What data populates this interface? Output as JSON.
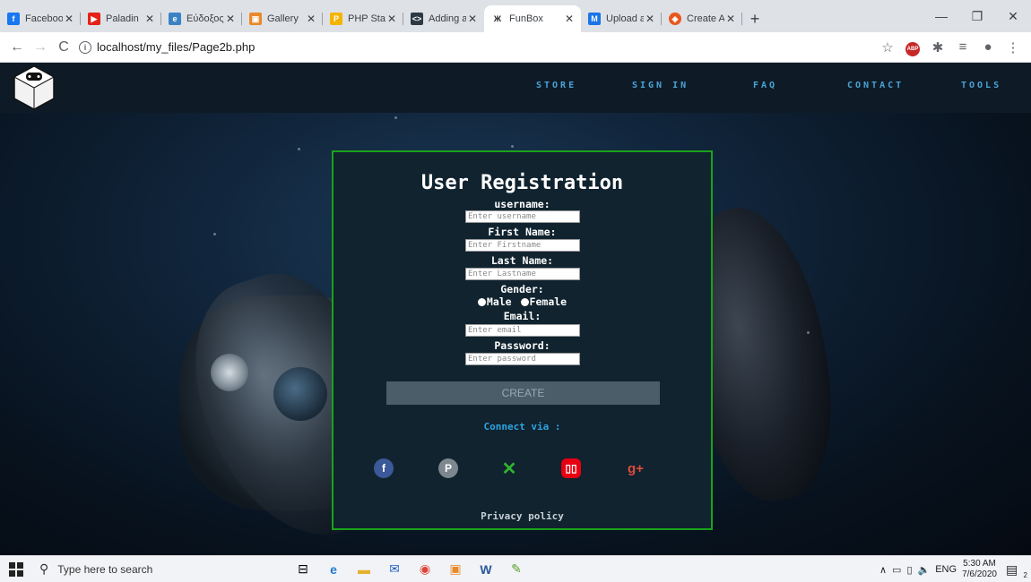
{
  "browser": {
    "tabs": [
      {
        "title": "Facebook",
        "icon": "facebook-icon",
        "color": "#1877f2"
      },
      {
        "title": "Paladin",
        "icon": "youtube-icon",
        "color": "#e62117"
      },
      {
        "title": "Εύδοξος | Σ",
        "icon": "eudoxus-icon",
        "color": "#3b82c4"
      },
      {
        "title": "Gallery",
        "icon": "gallery-icon",
        "color": "#e8892a"
      },
      {
        "title": "PHP Star Ra",
        "icon": "php-icon",
        "color": "#f4b400"
      },
      {
        "title": "Adding a G",
        "icon": "code-icon",
        "color": "#2d3a44"
      },
      {
        "title": "FunBox",
        "icon": "funbox-icon",
        "color": "#222222",
        "active": true
      },
      {
        "title": "Upload and",
        "icon": "upload-icon",
        "color": "#1a73e8"
      },
      {
        "title": "Create A Si",
        "icon": "create-icon",
        "color": "#e8581c"
      }
    ],
    "url": "localhost/my_files/Page2b.php"
  },
  "site": {
    "nav": {
      "store": "STORE",
      "signin": "SIGN IN",
      "faq": "FAQ",
      "contact": "CONTACT",
      "tools": "TOOLS"
    }
  },
  "form": {
    "title": "User Registration",
    "username_label": "username:",
    "username_placeholder": "Enter username",
    "firstname_label": "First Name:",
    "firstname_placeholder": "Enter Firstname",
    "lastname_label": "Last Name:",
    "lastname_placeholder": "Enter Lastname",
    "gender_label": "Gender:",
    "male_label": "Male",
    "female_label": "Female",
    "email_label": "Email:",
    "email_placeholder": "Enter email",
    "password_label": "Password:",
    "password_placeholder": "Enter password",
    "create_label": "CREATE",
    "connect_label": "Connect via :",
    "privacy_label": "Privacy policy"
  },
  "socials": [
    {
      "icon": "facebook-icon",
      "color": "#3b5998"
    },
    {
      "icon": "playstation-icon",
      "color": "#7d8790"
    },
    {
      "icon": "xbox-icon",
      "color": "#2fb52f"
    },
    {
      "icon": "nintendo-switch-icon",
      "color": "#e60012"
    },
    {
      "icon": "google-plus-icon",
      "color": "#dd4b39"
    }
  ],
  "taskbar": {
    "search_placeholder": "Type here to search",
    "language": "ENG",
    "time": "5:30 AM",
    "date": "7/6/2020",
    "notifications": "2"
  }
}
